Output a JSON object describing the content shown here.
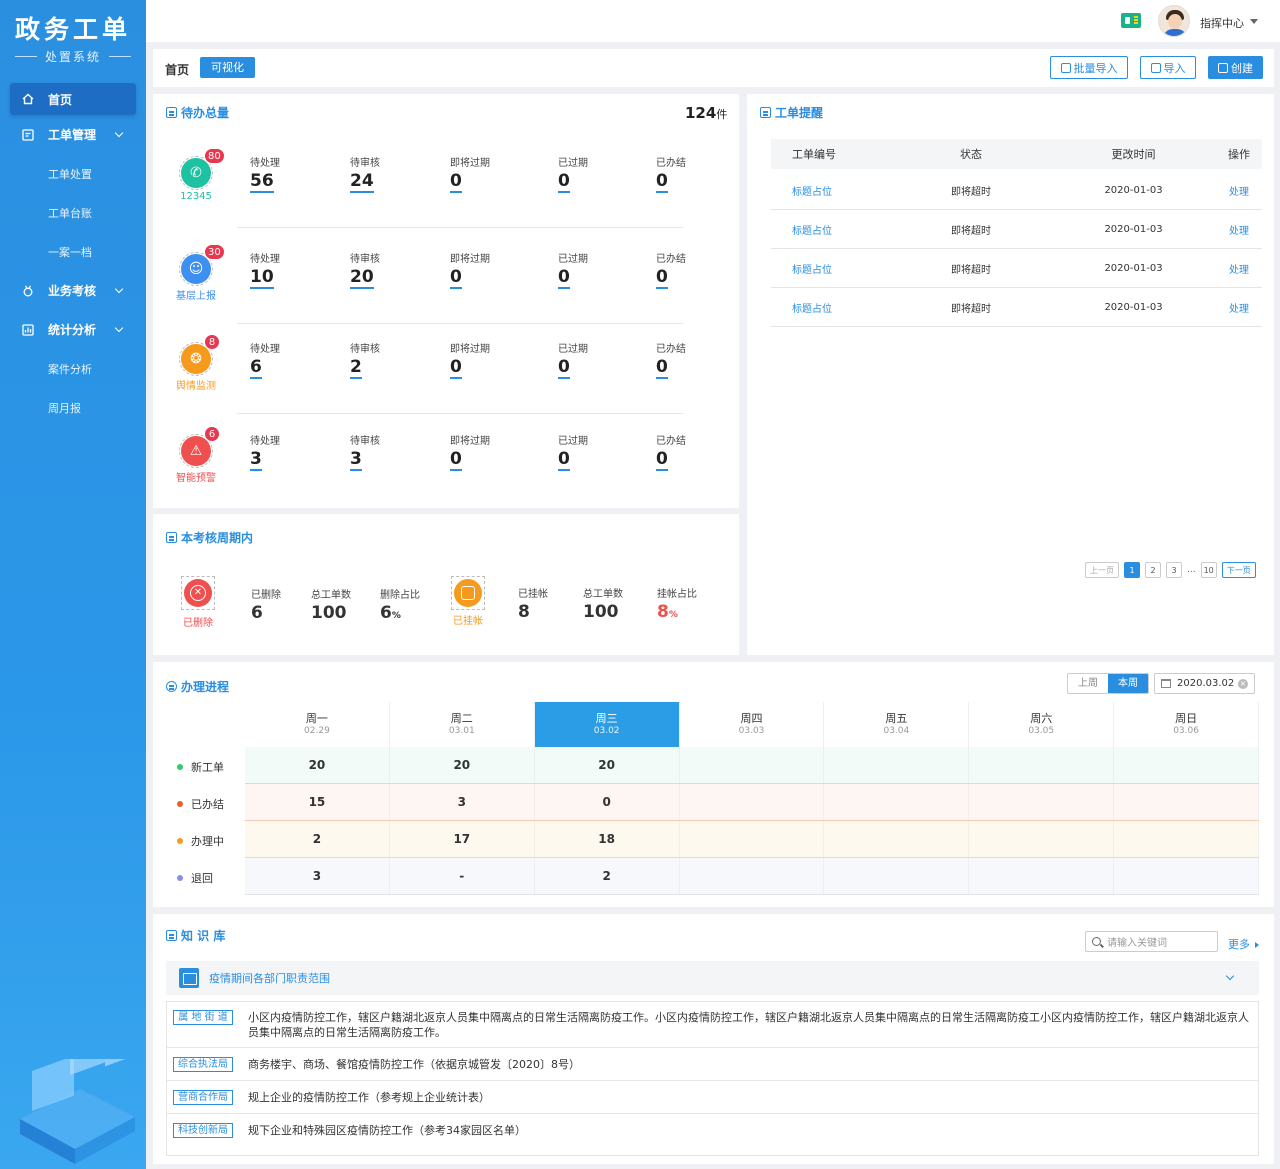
{
  "app": {
    "title": "政务工单",
    "subtitle": "处置系统"
  },
  "sidebar": {
    "items": [
      {
        "label": "首页",
        "icon": "home-icon",
        "active": true
      },
      {
        "label": "工单管理",
        "icon": "edit-icon",
        "expandable": true
      },
      {
        "label": "工单处置",
        "sub": true
      },
      {
        "label": "工单台账",
        "sub": true
      },
      {
        "label": "一案一档",
        "sub": true
      },
      {
        "label": "业务考核",
        "icon": "medal-icon",
        "expandable": true
      },
      {
        "label": "统计分析",
        "icon": "chart-icon",
        "expandable": true
      },
      {
        "label": "案件分析",
        "sub": true
      },
      {
        "label": "周月报",
        "sub": true
      }
    ]
  },
  "header": {
    "user_name": "指挥中心"
  },
  "toolbar": {
    "breadcrumb": "首页",
    "viz_button": "可视化",
    "batch_import": "批量导入",
    "import": "导入",
    "create": "创建"
  },
  "pending": {
    "title": "待办总量",
    "total": "124",
    "unit": "件",
    "stat_labels": [
      "待处理",
      "待审核",
      "即将过期",
      "已过期",
      "已办结"
    ],
    "sources": [
      {
        "name": "12345",
        "badge": "80",
        "color": "#1fc1a3",
        "label_color": "#1fc1a3",
        "icon": "phone-icon",
        "values": [
          "56",
          "24",
          "0",
          "0",
          "0"
        ]
      },
      {
        "name": "基层上报",
        "badge": "30",
        "color": "#3d8ff0",
        "label_color": "#3d8ff0",
        "icon": "user-icon",
        "values": [
          "10",
          "20",
          "0",
          "0",
          "0"
        ]
      },
      {
        "name": "舆情监测",
        "badge": "8",
        "color": "#f59a1d",
        "label_color": "#f59a1d",
        "icon": "group-icon",
        "values": [
          "6",
          "2",
          "0",
          "0",
          "0"
        ]
      },
      {
        "name": "智能预警",
        "badge": "6",
        "color": "#ef4f4f",
        "label_color": "#ef4f4f",
        "icon": "alarm-icon",
        "values": [
          "3",
          "3",
          "0",
          "0",
          "0"
        ]
      }
    ]
  },
  "period": {
    "title": "本考核周期内",
    "deleted": {
      "name": "已删除",
      "color": "#ef4f4f",
      "stats": [
        {
          "label": "已删除",
          "value": "6",
          "unit": ""
        },
        {
          "label": "总工单数",
          "value": "100",
          "unit": ""
        },
        {
          "label": "删除占比",
          "value": "6",
          "unit": "%"
        }
      ]
    },
    "hung": {
      "name": "已挂帐",
      "color": "#f59a1d",
      "stats": [
        {
          "label": "已挂帐",
          "value": "8",
          "unit": ""
        },
        {
          "label": "总工单数",
          "value": "100",
          "unit": ""
        },
        {
          "label": "挂帐占比",
          "value": "8",
          "unit": "%"
        }
      ]
    }
  },
  "reminder": {
    "title": "工单提醒",
    "columns": [
      "工单编号",
      "状态",
      "更改时间",
      "操作"
    ],
    "rows": [
      {
        "id": "标题占位",
        "status": "即将超时",
        "time": "2020-01-03",
        "action": "处理"
      },
      {
        "id": "标题占位",
        "status": "即将超时",
        "time": "2020-01-03",
        "action": "处理"
      },
      {
        "id": "标题占位",
        "status": "即将超时",
        "time": "2020-01-03",
        "action": "处理"
      },
      {
        "id": "标题占位",
        "status": "即将超时",
        "time": "2020-01-03",
        "action": "处理"
      }
    ],
    "pager": {
      "prev": "上一页",
      "pages": [
        "1",
        "2",
        "3"
      ],
      "ellipsis": "...",
      "last": "10",
      "next": "下一页"
    }
  },
  "progress": {
    "title": "办理进程",
    "toggle": [
      "上周",
      "本周"
    ],
    "date": "2020.03.02",
    "days": [
      {
        "name": "周一",
        "date": "02.29"
      },
      {
        "name": "周二",
        "date": "03.01"
      },
      {
        "name": "周三",
        "date": "03.02",
        "active": true
      },
      {
        "name": "周四",
        "date": "03.03"
      },
      {
        "name": "周五",
        "date": "03.04"
      },
      {
        "name": "周六",
        "date": "03.05"
      },
      {
        "name": "周日",
        "date": "03.06"
      }
    ],
    "rows": [
      {
        "label": "新工单",
        "dot": "#2ecc71",
        "bg": "#f3fbf9",
        "line": "#bfe9de",
        "values": [
          "20",
          "20",
          "20",
          "",
          "",
          "",
          ""
        ]
      },
      {
        "label": "已办结",
        "dot": "#ef5b2b",
        "bg": "#fdf6f2",
        "line": "#f2c9b5",
        "values": [
          "15",
          "3",
          "0",
          "",
          "",
          "",
          ""
        ]
      },
      {
        "label": "办理中",
        "dot": "#f59a1d",
        "bg": "#fdf9ef",
        "line": "#f3dca7",
        "values": [
          "2",
          "17",
          "18",
          "",
          "",
          "",
          ""
        ]
      },
      {
        "label": "退回",
        "dot": "#8b8cf0",
        "bg": "#f7f8fb",
        "line": "#e1e3ea",
        "values": [
          "3",
          "-",
          "2",
          "",
          "",
          "",
          ""
        ]
      }
    ]
  },
  "knowledge": {
    "title": "知 识 库",
    "search_placeholder": "请输入关键词",
    "more": "更多",
    "section": "疫情期间各部门职责范围",
    "items": [
      {
        "tag": "属 地 街 道",
        "text": "小区内疫情防控工作，辖区户籍湖北返京人员集中隔离点的日常生活隔离防疫工作。小区内疫情防控工作，辖区户籍湖北返京人员集中隔离点的日常生活隔离防疫工小区内疫情防控工作，辖区户籍湖北返京人员集中隔离点的日常生活隔离防疫工作。"
      },
      {
        "tag": "综合执法局",
        "text": "商务楼宇、商场、餐馆疫情防控工作（依据京城管发〔2020〕8号）"
      },
      {
        "tag": "营商合作局",
        "text": "规上企业的疫情防控工作（参考规上企业统计表）"
      },
      {
        "tag": "科技创新局",
        "text": "规下企业和特殊园区疫情防控工作（参考34家园区名单）"
      }
    ]
  }
}
